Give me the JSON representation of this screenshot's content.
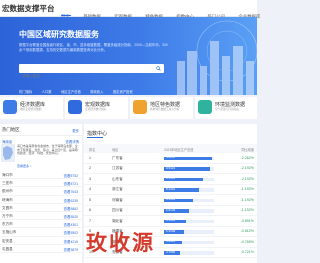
{
  "nav": {
    "brand": "宏数据支撑平台",
    "items": [
      "首页",
      "基础数据",
      "宏观数据",
      "特色数据",
      "指数中心",
      "热门公司",
      "企业数据库"
    ],
    "active_index": 0
  },
  "hero": {
    "title": "中国区域研究数据服务",
    "description": "数据平台覆盖全国各级行政区、省、市、县多维度数据，覆盖多级统计指标、2000—当前年份、300余个常用数据源，支持历史数据与最新数据查询对比分析。",
    "search_placeholder": "请输入搜索",
    "tags": [
      "热门指标",
      "人口数",
      "地区生产总值",
      "财政收入",
      "固定资产投资"
    ]
  },
  "cards": [
    {
      "title": "经济数据库",
      "desc": "地区宏观经济数据",
      "color": "#3d7be6"
    },
    {
      "title": "宏观数据库",
      "desc": "宏观经济统计指标",
      "color": "#2f6bdf"
    },
    {
      "title": "地区特色数据",
      "desc": "各地特色数据汇总与分析",
      "color": "#f0a22e"
    },
    {
      "title": "环境监测数据",
      "desc": "空气质量与环境指标",
      "color": "#2fb39e"
    }
  ],
  "left_panel": {
    "title": "热门地区",
    "more": "更多",
    "region": "海南省",
    "region_link": "查看详情",
    "intro": "海口市是海南省省会城市，位于海南岛北部，全市下辖秀英、龙华、琼山、美兰四个区，是海南省政治、经济、科技、文化中心。",
    "link": "查看更多 >",
    "rows": [
      {
        "label": "海口市",
        "value": "查看8752"
      },
      {
        "label": "三亚市",
        "value": "查看8721"
      },
      {
        "label": "儋州市",
        "value": "查看7643"
      },
      {
        "label": "琼海市",
        "value": "查看6235"
      },
      {
        "label": "文昌市",
        "value": "查看5862"
      },
      {
        "label": "万宁市",
        "value": "查看5520"
      },
      {
        "label": "东方市",
        "value": "查看4301"
      },
      {
        "label": "五指山市",
        "value": "查看5502"
      },
      {
        "label": "定安县",
        "value": "查看4216"
      },
      {
        "label": "屯昌县",
        "value": "查看3879"
      }
    ]
  },
  "index_center": {
    "title": "指数中心",
    "headers": [
      "排名",
      "地区",
      "2023年地区生产总值",
      "同比增速"
    ],
    "rows": [
      {
        "rank": "1",
        "name": "广东省",
        "value": "9.6235",
        "bar": 0.95,
        "pct": "-2.262%"
      },
      {
        "rank": "2",
        "name": "江苏省",
        "value": "9.5421",
        "bar": 0.92,
        "pct": "-2.192%"
      },
      {
        "rank": "3",
        "name": "山东省",
        "value": "8.5445",
        "bar": 0.78,
        "pct": "-2.192%"
      },
      {
        "rank": "4",
        "name": "浙江省",
        "value": "8.2431",
        "bar": 0.7,
        "pct": "-1.192%"
      },
      {
        "rank": "5",
        "name": "河南省",
        "value": "6.4901",
        "bar": 0.58,
        "pct": "-1.192%"
      },
      {
        "rank": "6",
        "name": "四川省",
        "value": "6.0133",
        "bar": 0.5,
        "pct": "-1.192%"
      },
      {
        "rank": "7",
        "name": "湖北省",
        "value": "5.5803",
        "bar": 0.44,
        "pct": "-0.891%"
      },
      {
        "rank": "8",
        "name": "福建省",
        "value": "5.3109",
        "bar": 0.4,
        "pct": "-0.812%"
      },
      {
        "rank": "9",
        "name": "湖南省",
        "value": "5.0012",
        "bar": 0.36,
        "pct": "-0.765%"
      },
      {
        "rank": "10",
        "name": "安徽省",
        "value": "4.7050",
        "bar": 0.32,
        "pct": "-0.721%"
      }
    ]
  },
  "watermark": "玫收源"
}
